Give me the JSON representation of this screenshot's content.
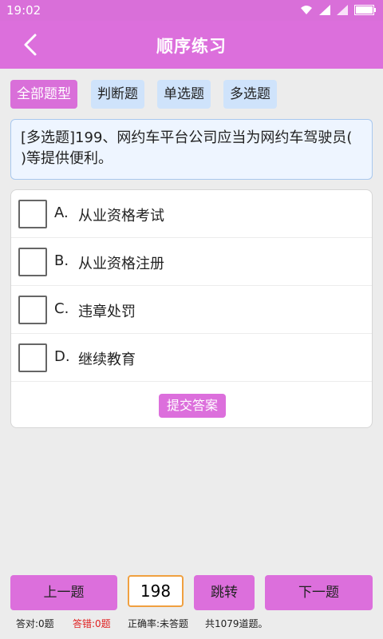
{
  "status_bar": {
    "time": "19:02",
    "icons": [
      "wifi-icon",
      "signal-icon",
      "signal-icon",
      "battery-icon"
    ]
  },
  "header": {
    "title": "顺序练习",
    "back_icon": "chevron-left-icon"
  },
  "filters": [
    {
      "label": "全部题型",
      "active": true
    },
    {
      "label": "判断题",
      "active": false
    },
    {
      "label": "单选题",
      "active": false
    },
    {
      "label": "多选题",
      "active": false
    }
  ],
  "question": {
    "text": "[多选题]199、网约车平台公司应当为网约车驾驶员( )等提供便利。"
  },
  "options": [
    {
      "key": "A.",
      "text": "从业资格考试"
    },
    {
      "key": "B.",
      "text": "从业资格注册"
    },
    {
      "key": "C.",
      "text": "违章处罚"
    },
    {
      "key": "D.",
      "text": "继续教育"
    }
  ],
  "submit_label": "提交答案",
  "nav": {
    "prev": "上一题",
    "jump_value": "198",
    "jump": "跳转",
    "next": "下一题"
  },
  "stats": {
    "correct": "答对:0题",
    "wrong": "答错:0题",
    "accuracy": "正确率:未答题",
    "total": "共1079道题。"
  },
  "colors": {
    "accent": "#dc6fdc",
    "chip": "#cfe3fb",
    "wrong": "#e02020"
  }
}
